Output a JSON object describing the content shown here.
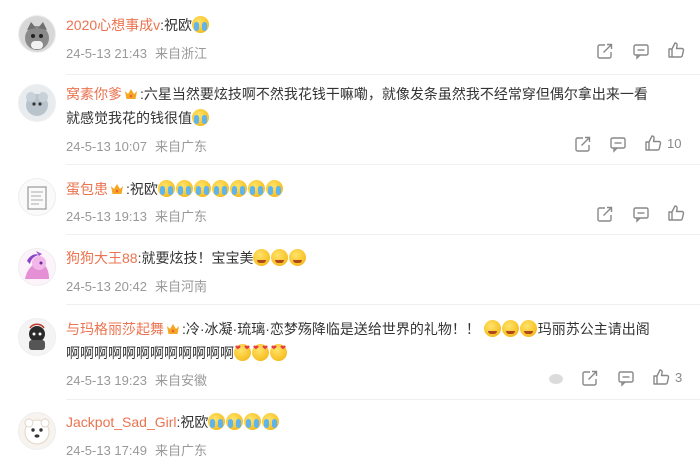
{
  "comments": [
    {
      "username": "2020心想事成v",
      "crown": false,
      "separator": ":",
      "text_line1": "祝欧",
      "text_line2": "",
      "emojis_line1": [
        "crying"
      ],
      "emojis_line2": [],
      "date": "24-5-13 21:43",
      "location": "来自浙江",
      "like_count": ""
    },
    {
      "username": "窝素你爹",
      "crown": true,
      "separator": ":",
      "text_line1": "六星当然要炫技啊不然我花钱干嘛嘞，就像发条虽然我不经常穿但偶尔拿出来一看",
      "text_line2": "就感觉我花的钱很值",
      "emojis_line1": [],
      "emojis_line2": [
        "crying"
      ],
      "date": "24-5-13 10:07",
      "location": "来自广东",
      "like_count": "10"
    },
    {
      "username": "蛋包患",
      "crown": true,
      "separator": ":",
      "text_line1": "祝欧",
      "text_line2": "",
      "emojis_line1": [
        "crying",
        "crying",
        "crying",
        "crying",
        "crying",
        "crying",
        "crying"
      ],
      "emojis_line2": [],
      "date": "24-5-13 19:13",
      "location": "来自广东",
      "like_count": ""
    },
    {
      "username": "狗狗大王88",
      "crown": false,
      "separator": ":",
      "text_line1": "就要炫技！宝宝美",
      "text_line2": "",
      "emojis_line1": [
        "wink",
        "wink",
        "wink"
      ],
      "emojis_line2": [],
      "date": "24-5-13 20:42",
      "location": "来自河南",
      "like_count": ""
    },
    {
      "username": "与玛格丽莎起舞",
      "crown": true,
      "separator": ":",
      "text_line1": "冷·冰凝·琉璃·恋梦殇降临是送给世界的礼物！！",
      "text_line1_after": "玛丽苏公主请出阁",
      "text_line2": "啊啊啊啊啊啊啊啊啊啊啊啊",
      "emojis_line1": [
        "wink",
        "wink",
        "wink"
      ],
      "emojis_line2": [
        "heart",
        "heart",
        "heart"
      ],
      "date": "24-5-13 19:23",
      "location": "来自安徽",
      "like_count": "3"
    },
    {
      "username": "Jackpot_Sad_Girl",
      "crown": false,
      "separator": ":",
      "text_line1": "祝欧",
      "text_line2": "",
      "emojis_line1": [
        "crying",
        "crying",
        "crying",
        "crying"
      ],
      "emojis_line2": [],
      "date": "24-5-13 17:49",
      "location": "来自广东",
      "like_count": ""
    }
  ],
  "colors": {
    "username": "#eb7350",
    "meta": "#999999",
    "text": "#333333",
    "icon": "#888888"
  },
  "icons": {
    "share": "share-icon",
    "comment": "comment-icon",
    "like": "thumbs-up-icon",
    "crown": "crown-badge-icon"
  }
}
